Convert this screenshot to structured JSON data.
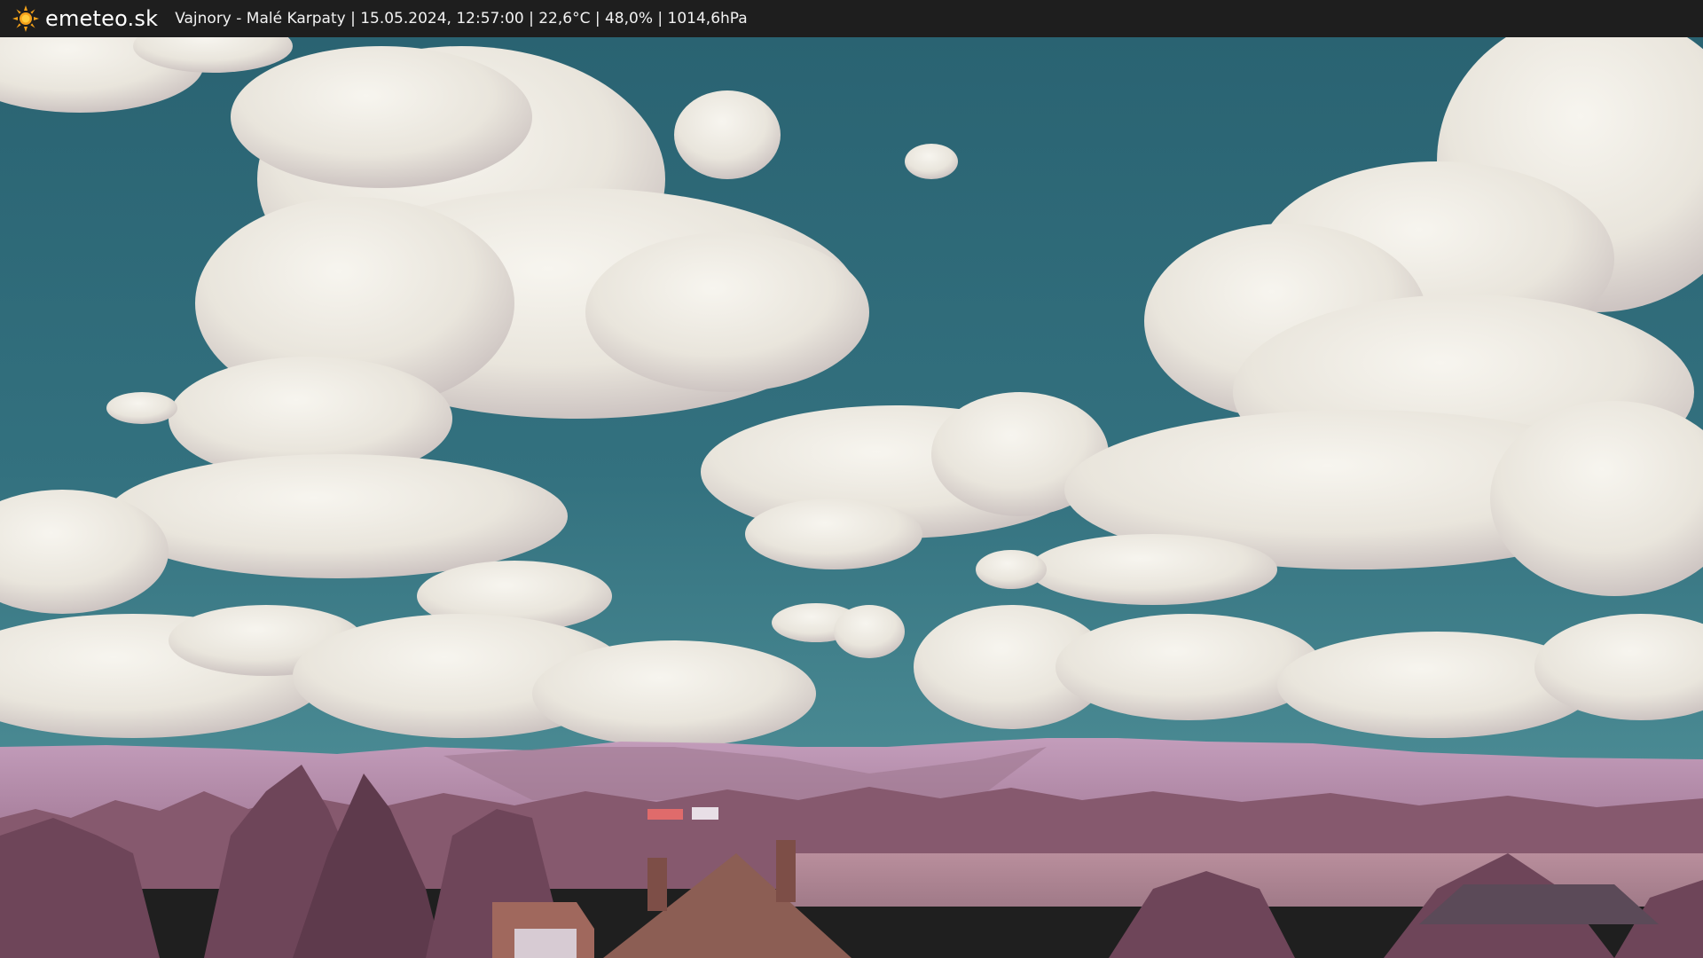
{
  "header": {
    "logo_text": "emeteo.sk",
    "caption": "Vajnory - Malé Karpaty | 15.05.2024, 12:57:00 | 22,6°C | 48,0% | 1014,6hPa",
    "logo_icon": "sun-icon",
    "background_color": "#1e1e1e",
    "logo_color": "#f4a11a"
  },
  "scene": {
    "sky_color": "#2f6b78",
    "hills_color": "#b892b0",
    "foliage_color": "#7a4f62"
  }
}
